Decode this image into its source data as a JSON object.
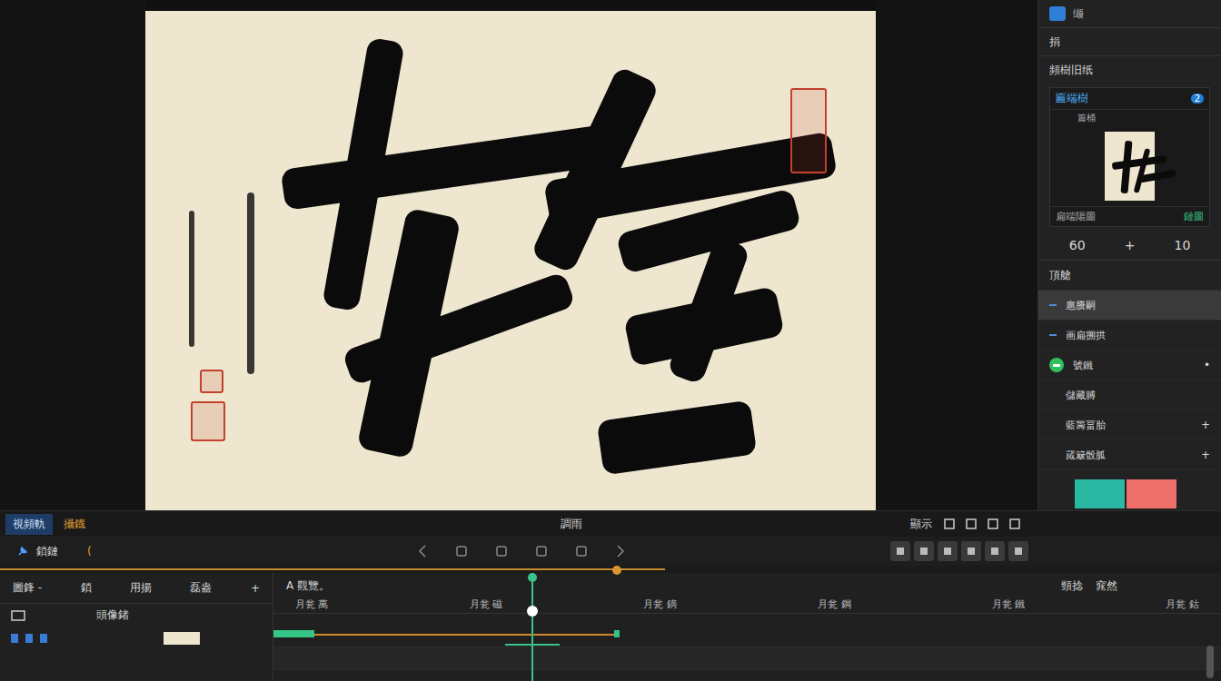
{
  "right_panel": {
    "tab": "缬",
    "field": "捐",
    "section_title": "頻樹旧纸",
    "card": {
      "header": "匾端樹",
      "badge": "2",
      "caption": "篇桶",
      "footer_left": "扁端陽圖",
      "footer_right": "鏈圖"
    },
    "stepper": [
      "60",
      "+",
      "10"
    ],
    "list_title": "頂艙",
    "items": [
      {
        "label": "扈賸嗣",
        "selected": true,
        "kind": "dash",
        "on": false,
        "trailing": ""
      },
      {
        "label": "画扁搠拱",
        "selected": false,
        "kind": "dash",
        "on": false,
        "trailing": ""
      },
      {
        "label": "號鐵",
        "selected": false,
        "kind": "toggle",
        "on": true,
        "trailing": "•"
      },
      {
        "label": "儲藏膊",
        "selected": false,
        "kind": "plain",
        "on": false,
        "trailing": ""
      },
      {
        "label": "藍籌畐胎",
        "selected": false,
        "kind": "plain",
        "on": false,
        "trailing": "+"
      },
      {
        "label": "蕆簸骰胍",
        "selected": false,
        "kind": "plain",
        "on": false,
        "trailing": "+"
      }
    ],
    "swatches": [
      {
        "color": "#2bb8a2"
      },
      {
        "color": "#ef6f6a"
      }
    ]
  },
  "viewer_bar": {
    "tabs": [
      {
        "label": "視頻軌",
        "selected": true
      },
      {
        "label": "攝鐡",
        "selected": false
      }
    ],
    "center": "調雨",
    "right": "顯示"
  },
  "transport": {
    "label": "鎖鏈",
    "marker": "("
  },
  "scrub": {
    "level": 0.505
  },
  "timeline": {
    "header": [
      "圖鋒 -",
      "鎖",
      "用揚",
      "磊盎",
      "+"
    ],
    "track_label": "頭像鍺",
    "ruler_title": "A 觀覽。",
    "right_labels": [
      "頸捻",
      "窕然"
    ],
    "ruler": [
      "月瓮 萬",
      "月瓮 磁",
      "月瓮 鏑",
      "月瓮 鋼",
      "月瓮 鐵",
      "月瓮 鈷"
    ],
    "clip": {
      "level": 0.36
    },
    "playhead": {
      "level": 0.272
    }
  }
}
